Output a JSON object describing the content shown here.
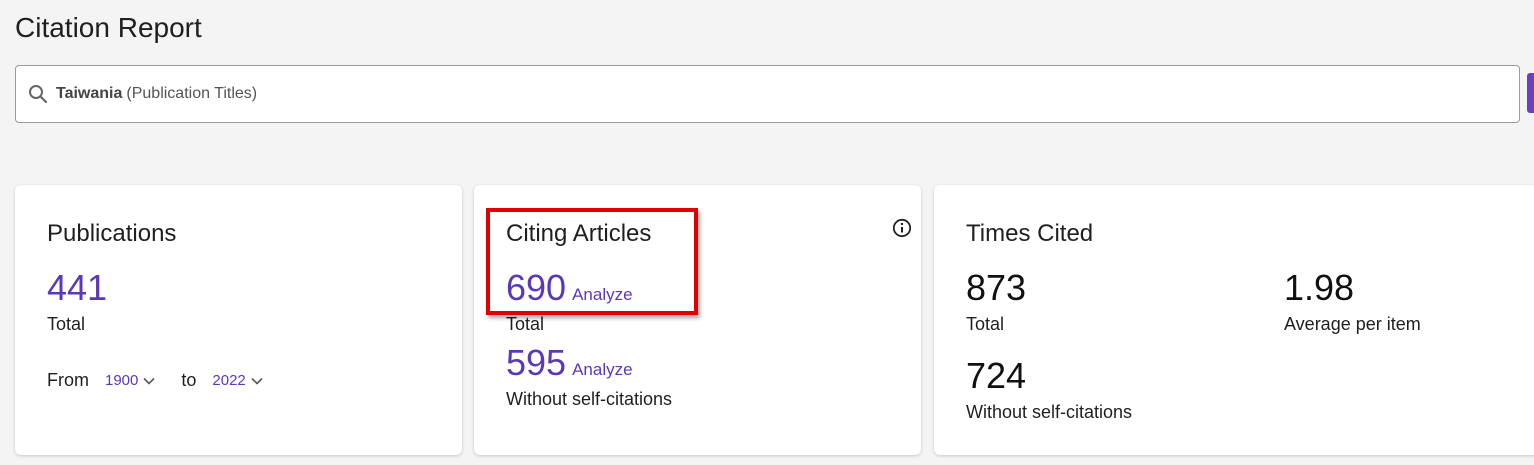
{
  "page": {
    "title": "Citation Report"
  },
  "search": {
    "term": "Taiwania",
    "field": "(Publication Titles)"
  },
  "publications": {
    "title": "Publications",
    "total_value": "441",
    "total_label": "Total",
    "from_label": "From",
    "from_year": "1900",
    "to_label": "to",
    "to_year": "2022"
  },
  "citing_articles": {
    "title": "Citing Articles",
    "total_value": "690",
    "total_analyze": "Analyze",
    "total_label": "Total",
    "without_value": "595",
    "without_analyze": "Analyze",
    "without_label": "Without self-citations"
  },
  "times_cited": {
    "title": "Times Cited",
    "total_value": "873",
    "total_label": "Total",
    "average_value": "1.98",
    "average_label": "Average per item",
    "without_value": "724",
    "without_label": "Without self-citations"
  },
  "colors": {
    "accent": "#5b38b8",
    "highlight": "#e00000",
    "tab": "#6b3fc8"
  }
}
